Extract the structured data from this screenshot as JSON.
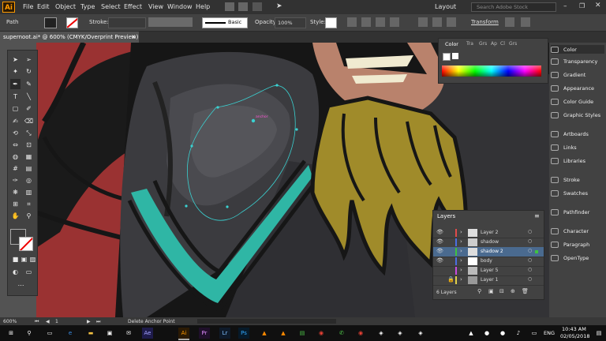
{
  "app": {
    "logo": "Ai"
  },
  "menu": [
    "File",
    "Edit",
    "Object",
    "Type",
    "Select",
    "Effect",
    "View",
    "Window",
    "Help"
  ],
  "menubar_right": {
    "layout": "Layout",
    "search_placeholder": "Search Adobe Stock"
  },
  "control": {
    "path_label": "Path",
    "stroke_label": "Stroke:",
    "brush": "Basic",
    "opacity_label": "Opacity:",
    "opacity_value": "100%",
    "style_label": "Style:",
    "transform": "Transform"
  },
  "document_tab": "supernoot.ai* @ 600% (CMYK/Overprint Preview)",
  "canvas": {
    "anchor_tooltip": "anchor"
  },
  "color_panel": {
    "tabs": [
      "Color",
      "Tra",
      "Grs",
      "Ap",
      "Cl",
      "Grs"
    ]
  },
  "dock": [
    "Color",
    "Transparency",
    "Gradient",
    "Appearance",
    "Color Guide",
    "Graphic Styles",
    "Artboards",
    "Links",
    "Libraries",
    "Stroke",
    "Swatches",
    "Pathfinder",
    "Character",
    "Paragraph",
    "OpenType"
  ],
  "layers_panel": {
    "title": "Layers",
    "layers": [
      {
        "name": "Layer 2",
        "color": "#e14b4b"
      },
      {
        "name": "shadow",
        "color": "#4b6fe1"
      },
      {
        "name": "shadow 2",
        "color": "#3fc23f",
        "selected": true
      },
      {
        "name": "body",
        "color": "#4b6fe1"
      },
      {
        "name": "Layer 5",
        "color": "#c94be1"
      },
      {
        "name": "Layer 1",
        "color": "#e1d04b"
      }
    ],
    "count": "6 Layers"
  },
  "status": {
    "zoom": "600%",
    "artboard": "1",
    "tool": "Delete Anchor Point"
  },
  "taskbar": {
    "lang": "ENG",
    "time": "10:43 AM",
    "date": "02/05/2018"
  },
  "colors": {
    "red": "#9a3232",
    "teal": "#2fb6a5",
    "mustard": "#a08b2a",
    "path": "#3ad1d1"
  }
}
